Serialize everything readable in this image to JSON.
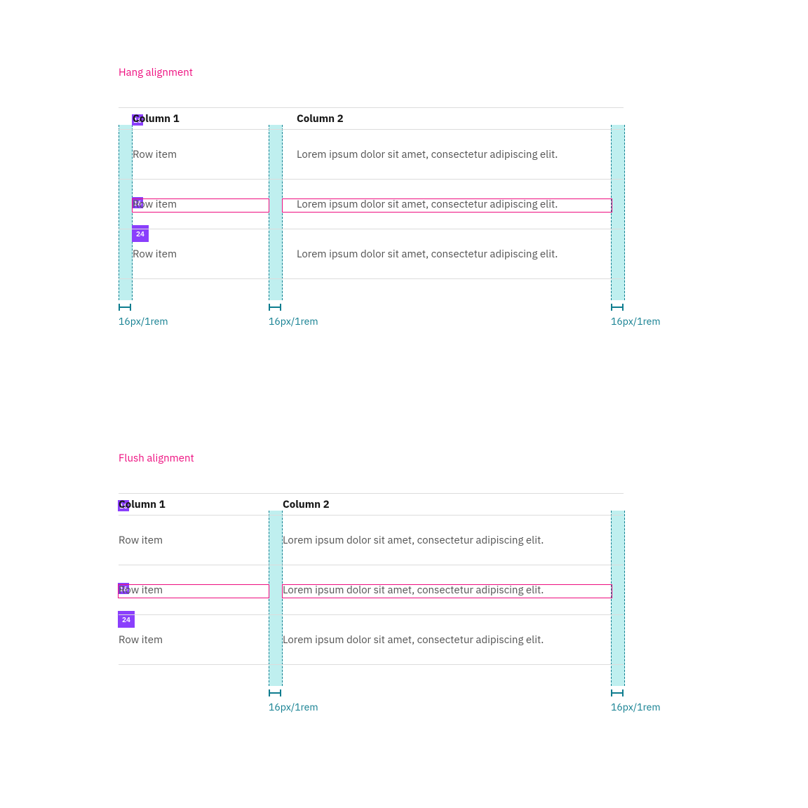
{
  "hang": {
    "title": "Hang alignment",
    "header": {
      "col1": "Column 1",
      "col2": "Column 2"
    },
    "rows": [
      {
        "c1": "Row item",
        "c2": "Lorem ipsum dolor sit amet, consectetur adipiscing elit."
      },
      {
        "c1": "Row item",
        "c2": "Lorem ipsum dolor sit amet, consectetur adipiscing elit."
      },
      {
        "c1": "Row item",
        "c2": "Lorem ipsum dolor sit amet, consectetur adipiscing elit."
      }
    ],
    "spacers": {
      "top": "16",
      "mid": "16",
      "bottom": "24"
    },
    "measure_label": "16px/1rem"
  },
  "flush": {
    "title": "Flush alignment",
    "header": {
      "col1": "Column 1",
      "col2": "Column 2"
    },
    "rows": [
      {
        "c1": "Row item",
        "c2": "Lorem ipsum dolor sit amet, consectetur adipiscing elit."
      },
      {
        "c1": "Row item",
        "c2": "Lorem ipsum dolor sit amet, consectetur adipiscing elit."
      },
      {
        "c1": "Row item",
        "c2": "Lorem ipsum dolor sit amet, consectetur adipiscing elit."
      }
    ],
    "spacers": {
      "top": "16",
      "mid": "16",
      "bottom": "24"
    },
    "measure_label": "16px/1rem"
  }
}
